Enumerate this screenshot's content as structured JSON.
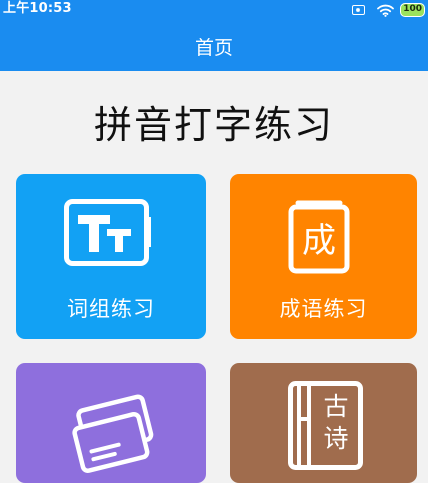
{
  "status_bar": {
    "time": "上午10:53",
    "battery": "100",
    "icons": [
      "sim-card-icon",
      "wifi-icon",
      "battery-icon"
    ]
  },
  "nav": {
    "title": "首页"
  },
  "page": {
    "title": "拼音打字练习"
  },
  "cards": [
    {
      "label": "词组练习",
      "icon": "font-size-tt-icon",
      "color": "#12a1f4"
    },
    {
      "label": "成语练习",
      "icon": "idiom-book-icon",
      "color": "#ff8400"
    },
    {
      "label": "",
      "icon": "cards-icon",
      "color": "#8e6fdd"
    },
    {
      "label": "",
      "icon": "poem-book-icon",
      "color": "#a06c4d",
      "icon_text": [
        "古",
        "诗"
      ]
    }
  ],
  "icon_glyphs": {
    "idiom": "成"
  },
  "colors": {
    "header": "#1a8cf0",
    "background": "#f2f2f2"
  }
}
